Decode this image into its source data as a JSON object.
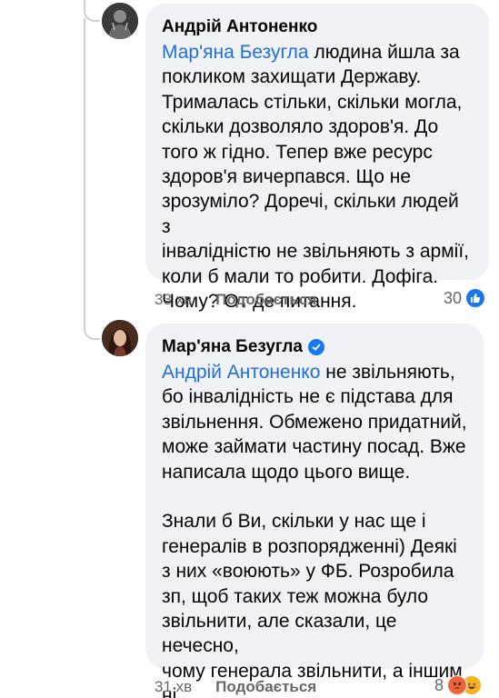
{
  "comment1": {
    "author": "Андрій Антоненко",
    "mention": "Мар'яна Безугла",
    "body": " людина йшла за\nпокликом захищати Державу.\nТрималась стільки, скільки могла,\nскільки дозволяло здоров'я. До\nтого ж гідно. Тепер вже ресурс\nздоров'я вичерпався. Що не\nзрозуміло? Доречі, скільки людей з\nінвалідністю не звільняють з армії,\nколи б мали то робити. Дофіга.\nЧому? От де питання.",
    "time": "33 хв",
    "like_label": "Подобається",
    "reaction_count": "30"
  },
  "comment2": {
    "author": "Мар'яна Безугла",
    "mention": "Андрій Антоненко",
    "body": " не звільняють,\nбо інвалідність не є підстава для\nзвільнення. Обмежено придатний,\nможе займати частину посад. Вже\nнаписала щодо цього вище.\n\nЗнали б Ви, скільки у нас ще і\nгенералів в розпорядженні) Деякі\nз них «воюють» у ФБ. Розробила\nзп, щоб таких теж можна було\nзвільнити, але сказали, це нечесно,\nчому генерала звільнити, а іншим\nні.",
    "time": "31 хв",
    "like_label": "Подобається",
    "reaction_count": "8"
  },
  "colors": {
    "mention": "#216fdb",
    "bubble": "#f0f2f5",
    "meta": "#65676b",
    "like_reaction": "#1877f2",
    "angry_reaction": "#f0633b",
    "haha_reaction": "#f7b125"
  },
  "icons": [
    "like-reaction-icon",
    "angry-reaction-icon",
    "haha-reaction-icon",
    "verified-badge-icon"
  ]
}
